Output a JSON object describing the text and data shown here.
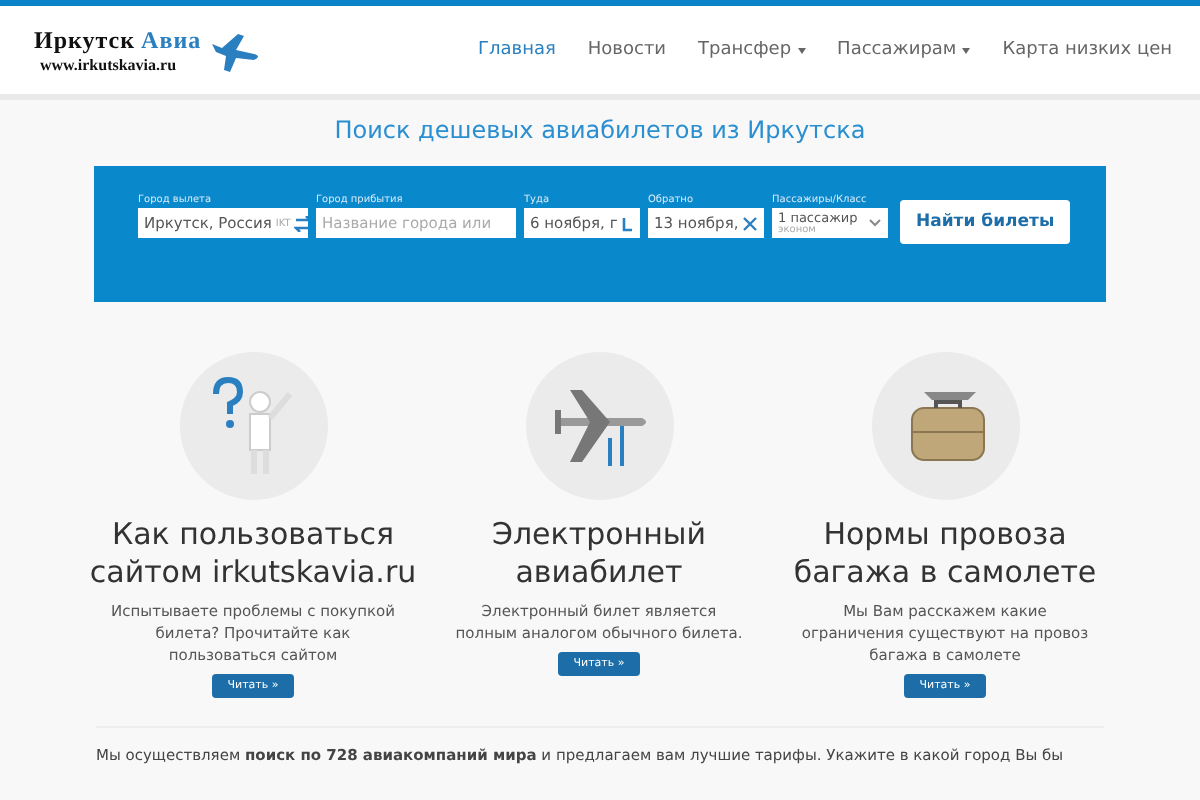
{
  "logo": {
    "name_part1": "Иркутск",
    "name_part2": "Авиа",
    "url": "www.irkutskavia.ru"
  },
  "nav": [
    {
      "label": "Главная",
      "selected": true,
      "has_dropdown": false
    },
    {
      "label": "Новости",
      "selected": false,
      "has_dropdown": false
    },
    {
      "label": "Трансфер",
      "selected": false,
      "has_dropdown": true
    },
    {
      "label": "Пассажирам",
      "selected": false,
      "has_dropdown": true
    },
    {
      "label": "Карта низких цен",
      "selected": false,
      "has_dropdown": false
    }
  ],
  "headline": "Поиск дешевых авиабилетов из Иркутска",
  "search_form": {
    "origin": {
      "label": "Город вылета",
      "value": "Иркутск, Россия",
      "code": "IKT"
    },
    "destination": {
      "label": "Город прибытия",
      "placeholder": "Название города или"
    },
    "depart": {
      "label": "Туда",
      "value": "6 ноября, г"
    },
    "return": {
      "label": "Обратно",
      "value": "13 ноября,"
    },
    "passengers": {
      "label": "Пассажиры/Класс",
      "value": "1 пассажир",
      "class": "эконом"
    },
    "submit": "Найти билеты"
  },
  "cards": [
    {
      "kind": "question",
      "title": "Как пользоваться сайтом irkutskavia.ru",
      "text": "Испытываете проблемы с покупкой билета? Прочитайте как пользоваться сайтом",
      "button": "Читать »"
    },
    {
      "kind": "plane",
      "title": "Электронный авиабилет",
      "text": "Электронный билет является полным аналогом обычного билета.",
      "button": "Читать »"
    },
    {
      "kind": "luggage",
      "title": "Нормы провоза багажа в самолете",
      "text": "Мы Вам расскажем какие ограничения существуют на провоз багажа в самолете",
      "button": "Читать »"
    }
  ],
  "intro": "Мы осуществляем **поиск по 728 авиакомпаний мира** и предлагаем вам лучшие тарифы. Укажите в какой город Вы бы"
}
